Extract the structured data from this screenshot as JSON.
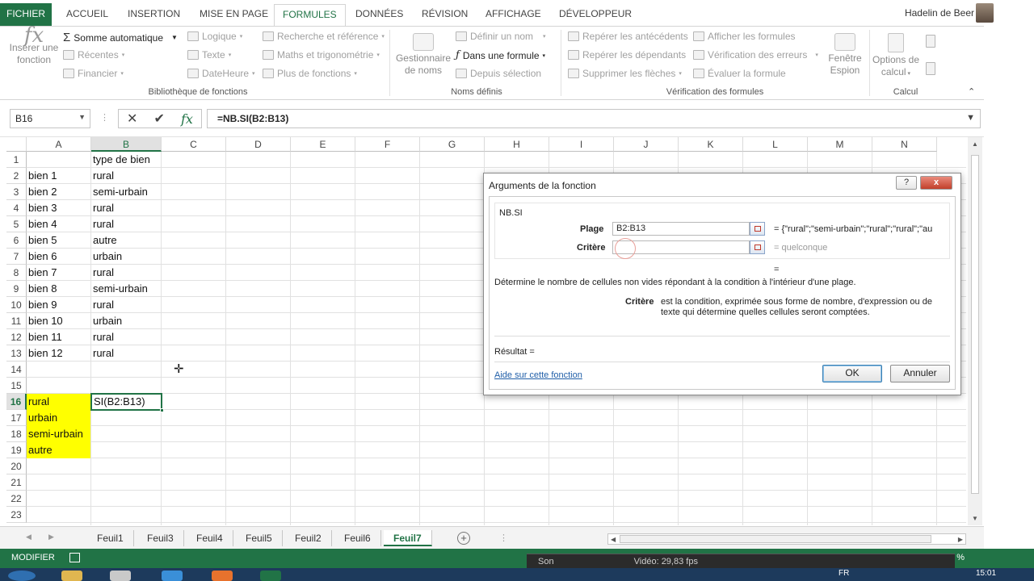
{
  "ribbon_tabs": [
    "FICHIER",
    "ACCUEIL",
    "INSERTION",
    "MISE EN PAGE",
    "FORMULES",
    "DONNÉES",
    "RÉVISION",
    "AFFICHAGE",
    "DÉVELOPPEUR"
  ],
  "active_tab": "FORMULES",
  "user_name": "Hadelin de Beer",
  "ribbon": {
    "insert_function": [
      "Insérer une",
      "fonction"
    ],
    "library": {
      "autosum": "Somme automatique",
      "recent": "Récentes",
      "financial": "Financier",
      "logical": "Logique",
      "text": "Texte",
      "datetime": "DateHeure",
      "lookup": "Recherche et référence",
      "math": "Maths et trigonométrie",
      "more": "Plus de fonctions",
      "group": "Bibliothèque de fonctions"
    },
    "names": {
      "manager": [
        "Gestionnaire",
        "de noms"
      ],
      "define": "Définir un nom",
      "use_in_formula": "Dans une formule",
      "from_selection": "Depuis sélection",
      "group": "Noms définis"
    },
    "audit": {
      "precedents": "Repérer les antécédents",
      "dependents": "Repérer les dépendants",
      "remove_arrows": "Supprimer les flèches",
      "show_formulas": "Afficher les formules",
      "error_check": "Vérification des erreurs",
      "evaluate": "Évaluer la formule",
      "watch": [
        "Fenêtre",
        "Espion"
      ],
      "group": "Vérification des formules"
    },
    "calc": {
      "options": [
        "Options de",
        "calcul"
      ],
      "group": "Calcul"
    }
  },
  "formula_bar": {
    "name_box": "B16",
    "formula": "=NB.SI(B2:B13)"
  },
  "grid": {
    "columns": [
      "A",
      "B",
      "C",
      "D",
      "E",
      "F",
      "G",
      "H",
      "I",
      "J",
      "K",
      "L",
      "M",
      "N"
    ],
    "rows": [
      "1",
      "2",
      "3",
      "4",
      "5",
      "6",
      "7",
      "8",
      "9",
      "10",
      "11",
      "12",
      "13",
      "14",
      "15",
      "16",
      "17",
      "18",
      "19",
      "20",
      "21",
      "22",
      "23"
    ],
    "col_a": [
      "",
      "bien 1",
      "bien 2",
      "bien 3",
      "bien 4",
      "bien 5",
      "bien 6",
      "bien 7",
      "bien 8",
      "bien 9",
      "bien 10",
      "bien 11",
      "bien 12",
      "",
      "",
      "rural",
      "urbain",
      "semi-urbain",
      "autre"
    ],
    "col_b": [
      "type de bien",
      "rural",
      "semi-urbain",
      "rural",
      "rural",
      "autre",
      "urbain",
      "rural",
      "semi-urbain",
      "rural",
      "urbain",
      "rural",
      "rural"
    ],
    "active_cell_text": "SI(B2:B13)",
    "highlight_color": "#ffff00"
  },
  "sheets": [
    "Feuil1",
    "Feuil3",
    "Feuil4",
    "Feuil5",
    "Feuil2",
    "Feuil6",
    "Feuil7"
  ],
  "active_sheet": "Feuil7",
  "status": {
    "mode": "MODIFIER",
    "percent": "%",
    "video_left": "Son",
    "video_mid": "Vidéo: 29,83 fps"
  },
  "taskbar": {
    "lang": "FR",
    "time": "15:01"
  },
  "dialog": {
    "title": "Arguments de la fonction",
    "help_btn": "?",
    "close_btn": "x",
    "function_name": "NB.SI",
    "arg1_label": "Plage",
    "arg1_value": "B2:B13",
    "arg1_result": "= {\"rural\";\"semi-urbain\";\"rural\";\"rural\";\"au",
    "arg2_label": "Critère",
    "arg2_value": "",
    "arg2_result": "= quelconque",
    "result_eq": "=",
    "description": "Détermine le nombre de cellules non vides répondant à la condition à l'intérieur d'une plage.",
    "arg_help_label": "Critère",
    "arg_help_text_1": "est la condition, exprimée sous forme de nombre, d'expression ou de",
    "arg_help_text_2": "texte qui détermine quelles cellules seront comptées.",
    "result_label": "Résultat =",
    "help_link": "Aide sur cette fonction",
    "ok": "OK",
    "cancel": "Annuler"
  },
  "colors": {
    "excel_green": "#217346",
    "selection_yellow": "#ffff00"
  }
}
